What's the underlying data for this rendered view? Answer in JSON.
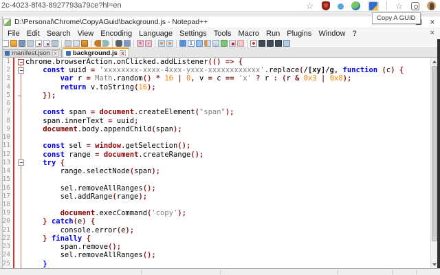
{
  "browser": {
    "url": "2c-4023-8f43-8927793a79ce?hl=en",
    "tooltip": "Copy A GUID",
    "icons": [
      {
        "name": "bookmark-star-icon",
        "cls": "ci-star",
        "glyph": "☆"
      },
      {
        "name": "adblock-shield-icon",
        "cls": "ci-shield"
      },
      {
        "name": "extension-dot-icon",
        "cls": "ci-dot"
      },
      {
        "name": "download-globe-icon",
        "cls": "ci-globe"
      },
      {
        "name": "copy-a-guid-extension-icon",
        "cls": "ci-ext",
        "highlighted": true
      },
      {
        "name": "toolbar-separator",
        "cls": "ci-sep"
      },
      {
        "name": "bookmark-star2-icon",
        "cls": "ci-star",
        "glyph": "☆"
      },
      {
        "name": "profile-frame-icon",
        "cls": "ci-profile"
      },
      {
        "name": "user-avatar",
        "cls": "ci-avatar"
      }
    ]
  },
  "window": {
    "title": "D:\\Personal\\Chrome\\CopyAGuid\\background.js - Notepad++",
    "maximize_glyph": "",
    "close_glyph": "×",
    "menu_close_glyph": "×"
  },
  "menu": {
    "items": [
      "File",
      "Edit",
      "Search",
      "View",
      "Encoding",
      "Language",
      "Settings",
      "Tools",
      "Macro",
      "Run",
      "Plugins",
      "Window",
      "?"
    ]
  },
  "toolbar": {
    "icons": [
      {
        "name": "new-file-icon",
        "cls": "tb-page"
      },
      {
        "name": "open-file-icon",
        "cls": "tb-folder"
      },
      {
        "name": "save-icon",
        "cls": "tb-save"
      },
      {
        "name": "save-all-icon",
        "cls": "tb-saveall"
      },
      {
        "name": "close-file-icon",
        "cls": "tb-close"
      },
      {
        "name": "close-all-icon",
        "cls": "tb-closeall"
      },
      {
        "name": "print-icon",
        "cls": "tb-print"
      },
      {
        "name": "separator",
        "cls": "sep"
      },
      {
        "name": "cut-icon",
        "cls": "tb-cut"
      },
      {
        "name": "copy-icon",
        "cls": "tb-copy"
      },
      {
        "name": "paste-icon",
        "cls": "tb-paste"
      },
      {
        "name": "separator",
        "cls": "sep"
      },
      {
        "name": "undo-icon",
        "cls": "tb-undo"
      },
      {
        "name": "redo-icon",
        "cls": "tb-redo"
      },
      {
        "name": "separator",
        "cls": "sep"
      },
      {
        "name": "find-icon",
        "cls": "tb-find"
      },
      {
        "name": "replace-icon",
        "cls": "tb-replace"
      },
      {
        "name": "separator",
        "cls": "sep"
      },
      {
        "name": "zoom-in-icon",
        "cls": "tb-zin",
        "label": "+"
      },
      {
        "name": "zoom-out-icon",
        "cls": "tb-zout",
        "label": "-"
      },
      {
        "name": "separator",
        "cls": "sep"
      },
      {
        "name": "sync-vertical-icon",
        "cls": "tb-sync"
      },
      {
        "name": "sync-horizontal-icon",
        "cls": "tb-sync"
      },
      {
        "name": "separator",
        "cls": "sep"
      },
      {
        "name": "word-wrap-icon",
        "cls": "tb-wrap"
      },
      {
        "name": "show-all-characters-icon",
        "cls": "tb-one",
        "label": "1"
      },
      {
        "name": "indent-guide-icon",
        "cls": "tb-indent"
      },
      {
        "name": "document-map-icon",
        "cls": "tb-docmap"
      },
      {
        "name": "function-list-icon",
        "cls": "tb-funclist"
      },
      {
        "name": "monitor-icon",
        "cls": "tb-monitor"
      },
      {
        "name": "pdf-icon",
        "cls": "tb-pdf"
      },
      {
        "name": "mail-icon",
        "cls": "tb-mail"
      },
      {
        "name": "separator",
        "cls": "sep"
      },
      {
        "name": "record-macro-icon",
        "cls": "tb-rec"
      },
      {
        "name": "stop-record-icon",
        "cls": "tb-dark"
      },
      {
        "name": "playback-macro-icon",
        "cls": "tb-dark"
      },
      {
        "name": "run-macro-multiple-icon",
        "cls": "tb-dark"
      },
      {
        "name": "save-macro-icon",
        "cls": "tb-bluewin"
      }
    ]
  },
  "tabs": [
    {
      "label": "manifest.json",
      "active": false,
      "close": "x"
    },
    {
      "label": "background.js",
      "active": true,
      "close": "x"
    }
  ],
  "editor": {
    "lines": [
      {
        "n": "1",
        "fold": "minus-red",
        "tokens": [
          [
            "pl",
            "chrome.browserAction.onClicked.addListener"
          ],
          [
            "op",
            "(() => {"
          ]
        ]
      },
      {
        "n": "2",
        "fold": "minus",
        "tokens": [
          [
            "pl",
            "    "
          ],
          [
            "kw",
            "const"
          ],
          [
            "pl",
            " uuid "
          ],
          [
            "op",
            "= "
          ],
          [
            "str",
            "'xxxxxxxx-xxxx-4xxx-yxxx-xxxxxxxxxxxx'"
          ],
          [
            "pl",
            ".replace"
          ],
          [
            "op",
            "("
          ],
          [
            "re",
            "/[xy]/g"
          ],
          [
            "op",
            ", "
          ],
          [
            "kw",
            "function"
          ],
          [
            "pl",
            " "
          ],
          [
            "op",
            "("
          ],
          [
            "pl",
            "c"
          ],
          [
            "op",
            ") {"
          ]
        ]
      },
      {
        "n": "3",
        "fold": "",
        "tokens": [
          [
            "pl",
            "        "
          ],
          [
            "kw",
            "var"
          ],
          [
            "pl",
            " r "
          ],
          [
            "op",
            "= "
          ],
          [
            "gr",
            "Math"
          ],
          [
            "pl",
            ".random"
          ],
          [
            "op",
            "() * "
          ],
          [
            "num",
            "16"
          ],
          [
            "op",
            " | "
          ],
          [
            "num",
            "0"
          ],
          [
            "op",
            ","
          ],
          [
            "pl",
            " v "
          ],
          [
            "op",
            "= "
          ],
          [
            "pl",
            "c "
          ],
          [
            "op",
            "== "
          ],
          [
            "str",
            "'x'"
          ],
          [
            "op",
            " ? "
          ],
          [
            "pl",
            "r "
          ],
          [
            "op",
            ": ("
          ],
          [
            "pl",
            "r "
          ],
          [
            "op",
            "& "
          ],
          [
            "num",
            "0x3"
          ],
          [
            "op",
            " | "
          ],
          [
            "num",
            "0x8"
          ],
          [
            "op",
            ");"
          ]
        ]
      },
      {
        "n": "4",
        "fold": "",
        "tokens": [
          [
            "pl",
            "        "
          ],
          [
            "kw",
            "return"
          ],
          [
            "pl",
            " v.toString"
          ],
          [
            "op",
            "("
          ],
          [
            "num",
            "16"
          ],
          [
            "op",
            ");"
          ]
        ]
      },
      {
        "n": "5",
        "fold": "tick",
        "tokens": [
          [
            "pl",
            "    "
          ],
          [
            "op",
            "});"
          ]
        ]
      },
      {
        "n": "6",
        "fold": "",
        "tokens": []
      },
      {
        "n": "7",
        "fold": "",
        "tokens": [
          [
            "pl",
            "    "
          ],
          [
            "kw",
            "const"
          ],
          [
            "pl",
            " span "
          ],
          [
            "op",
            "= "
          ],
          [
            "w2",
            "document"
          ],
          [
            "pl",
            ".createElement"
          ],
          [
            "op",
            "("
          ],
          [
            "str",
            "\"span\""
          ],
          [
            "op",
            ");"
          ]
        ]
      },
      {
        "n": "8",
        "fold": "",
        "tokens": [
          [
            "pl",
            "    span.innerText "
          ],
          [
            "op",
            "= "
          ],
          [
            "pl",
            "uuid"
          ],
          [
            "op",
            ";"
          ]
        ]
      },
      {
        "n": "9",
        "fold": "",
        "tokens": [
          [
            "pl",
            "    "
          ],
          [
            "w2",
            "document"
          ],
          [
            "pl",
            ".body.appendChild"
          ],
          [
            "op",
            "("
          ],
          [
            "pl",
            "span"
          ],
          [
            "op",
            ");"
          ]
        ]
      },
      {
        "n": "10",
        "fold": "",
        "tokens": []
      },
      {
        "n": "11",
        "fold": "",
        "tokens": [
          [
            "pl",
            "    "
          ],
          [
            "kw",
            "const"
          ],
          [
            "pl",
            " sel "
          ],
          [
            "op",
            "= "
          ],
          [
            "w2",
            "window"
          ],
          [
            "pl",
            ".getSelection"
          ],
          [
            "op",
            "();"
          ]
        ]
      },
      {
        "n": "12",
        "fold": "",
        "tokens": [
          [
            "pl",
            "    "
          ],
          [
            "kw",
            "const"
          ],
          [
            "pl",
            " range "
          ],
          [
            "op",
            "= "
          ],
          [
            "w2",
            "document"
          ],
          [
            "pl",
            ".createRange"
          ],
          [
            "op",
            "();"
          ]
        ]
      },
      {
        "n": "13",
        "fold": "minus",
        "tokens": [
          [
            "pl",
            "    "
          ],
          [
            "kw",
            "try"
          ],
          [
            "pl",
            " "
          ],
          [
            "op",
            "{"
          ]
        ]
      },
      {
        "n": "14",
        "fold": "",
        "tokens": [
          [
            "pl",
            "        range.selectNode"
          ],
          [
            "op",
            "("
          ],
          [
            "pl",
            "span"
          ],
          [
            "op",
            ");"
          ]
        ]
      },
      {
        "n": "15",
        "fold": "",
        "tokens": []
      },
      {
        "n": "16",
        "fold": "",
        "tokens": [
          [
            "pl",
            "        sel.removeAllRanges"
          ],
          [
            "op",
            "();"
          ]
        ]
      },
      {
        "n": "17",
        "fold": "",
        "tokens": [
          [
            "pl",
            "        sel.addRange"
          ],
          [
            "op",
            "("
          ],
          [
            "pl",
            "range"
          ],
          [
            "op",
            ");"
          ]
        ]
      },
      {
        "n": "18",
        "fold": "",
        "tokens": []
      },
      {
        "n": "19",
        "fold": "",
        "tokens": [
          [
            "pl",
            "        "
          ],
          [
            "w2",
            "document"
          ],
          [
            "pl",
            ".execCommand"
          ],
          [
            "op",
            "("
          ],
          [
            "str",
            "'copy'"
          ],
          [
            "op",
            ");"
          ]
        ]
      },
      {
        "n": "20",
        "fold": "",
        "tokens": [
          [
            "pl",
            "    "
          ],
          [
            "op",
            "} "
          ],
          [
            "kw",
            "catch"
          ],
          [
            "op",
            "("
          ],
          [
            "pl",
            "e"
          ],
          [
            "op",
            ") {"
          ]
        ]
      },
      {
        "n": "21",
        "fold": "",
        "tokens": [
          [
            "pl",
            "        console.error"
          ],
          [
            "op",
            "("
          ],
          [
            "pl",
            "e"
          ],
          [
            "op",
            ");"
          ]
        ]
      },
      {
        "n": "22",
        "fold": "",
        "tokens": [
          [
            "pl",
            "    "
          ],
          [
            "op",
            "} "
          ],
          [
            "kw",
            "finally"
          ],
          [
            "pl",
            " "
          ],
          [
            "op",
            "{"
          ]
        ]
      },
      {
        "n": "23",
        "fold": "",
        "tokens": [
          [
            "pl",
            "        span.remove"
          ],
          [
            "op",
            "();"
          ]
        ]
      },
      {
        "n": "24",
        "fold": "",
        "tokens": [
          [
            "pl",
            "        sel.removeAllRanges"
          ],
          [
            "op",
            "();"
          ]
        ]
      },
      {
        "n": "25",
        "fold": "",
        "tokens": [
          [
            "pl",
            "    "
          ],
          [
            "br",
            "}"
          ]
        ]
      }
    ]
  },
  "colors": {
    "keyword": "#0000ee",
    "word2": "#8b0000",
    "string": "#808080",
    "number": "#ff8000",
    "operator": "#8b2020",
    "active_tab_accent": "#ff9900",
    "change_bar": "#e0301e"
  }
}
